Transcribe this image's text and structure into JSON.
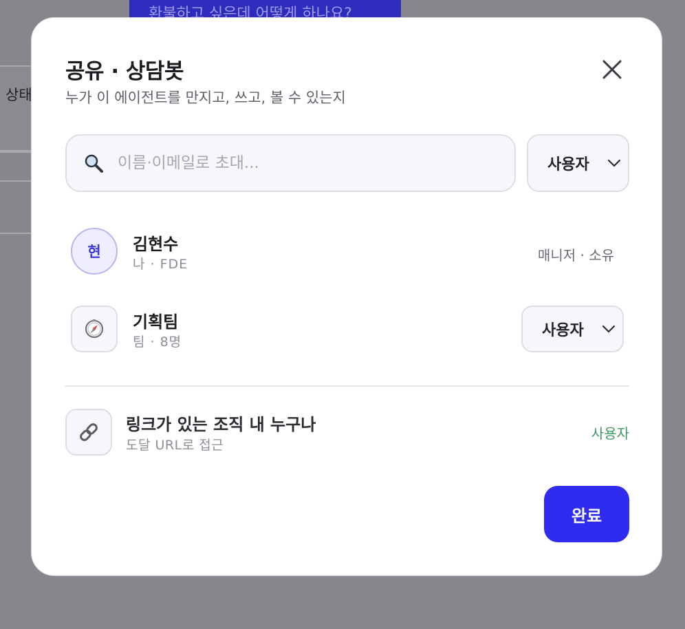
{
  "background": {
    "chip_text": "환불하고 싶은데 어떻게 하나요?",
    "side_label": "상태"
  },
  "modal": {
    "title": "공유 · 상담봇",
    "subtitle": "누가 이 에이전트를 만지고, 쓰고, 볼 수 있는지",
    "close_icon": "close-icon",
    "search": {
      "icon": "search-icon",
      "placeholder": "이름·이메일로 초대...",
      "value": ""
    },
    "invite_role": {
      "selected": "사용자"
    },
    "members": [
      {
        "avatar": "현",
        "name": "김현수",
        "subtitle": "나 · FDE",
        "role_text": "매니저 · 소유"
      },
      {
        "avatar_icon": "compass-icon",
        "name": "기획팀",
        "subtitle": "팀 · 8명",
        "role_select": "사용자"
      }
    ],
    "link_access": {
      "icon": "link-icon",
      "title": "링크가 있는 조직 내 누구나",
      "subtitle": "도달 URL로 접근",
      "role": "사용자",
      "role_color": "#3c9a62"
    },
    "done_label": "완료",
    "accent_color": "#2f2cf0"
  }
}
